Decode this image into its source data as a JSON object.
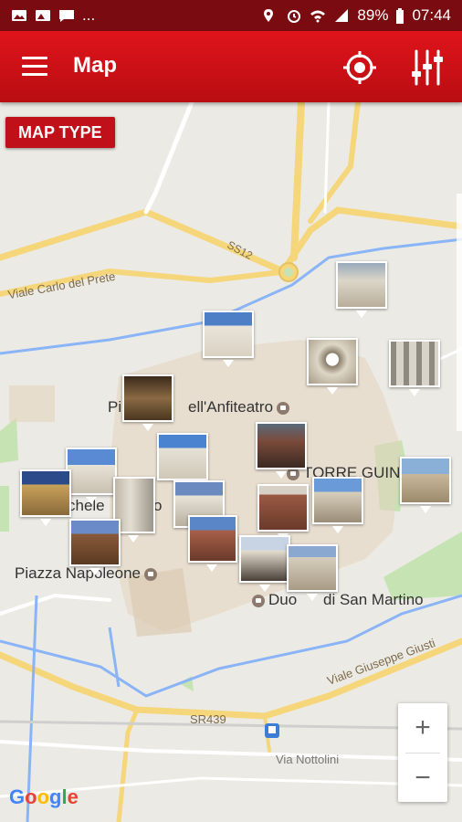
{
  "status_bar": {
    "battery": "89%",
    "time": "07:44",
    "more": "..."
  },
  "app_bar": {
    "title": "Map"
  },
  "map": {
    "map_type_button": "MAP TYPE",
    "place_labels": {
      "piazza_anfiteatro_a": "Pi",
      "piazza_anfiteatro_b": "ell'Anfiteatro",
      "torre_guinigi": "TORRE GUIN",
      "piazza_napoleone": "Piazza Napoleone",
      "duomo_a": "Duo",
      "duomo_b": "di San Martino",
      "michele_a": "chele",
      "michele_b": "o"
    },
    "road_labels": {
      "ss12": "SS12",
      "viale_carlo": "Viale Carlo del Prete",
      "viale_giusti": "Viale Giuseppe Giusti",
      "sr439": "SR439",
      "via_nottolini": "Via Nottolini"
    },
    "zoom": {
      "in": "+",
      "out": "−"
    },
    "attribution": {
      "g1": "G",
      "g2": "o",
      "g3": "o",
      "g4": "g",
      "g5": "l",
      "g6": "e"
    }
  }
}
